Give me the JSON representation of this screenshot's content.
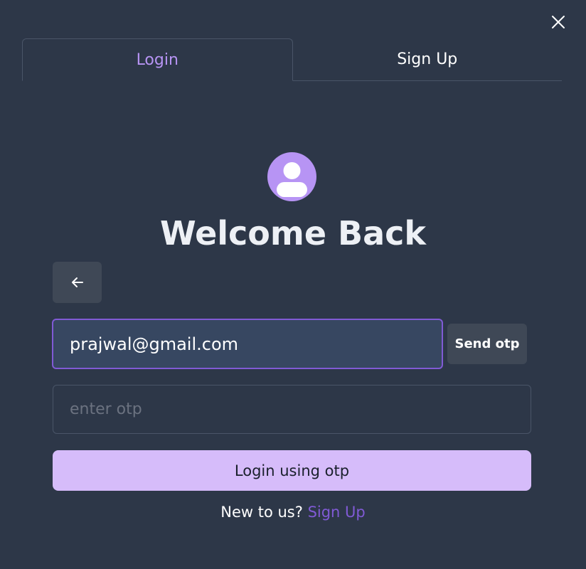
{
  "modal": {
    "close_icon": "close-icon",
    "tabs": [
      {
        "label": "Login",
        "active": true
      },
      {
        "label": "Sign Up",
        "active": false
      }
    ],
    "avatar_icon": "user-avatar-icon",
    "title": "Welcome Back",
    "back_icon": "arrow-left-icon",
    "email": {
      "value": "prajwal@gmail.com"
    },
    "send_otp_label": "Send otp",
    "otp": {
      "value": "",
      "placeholder": "enter otp"
    },
    "login_label": "Login using otp",
    "footer": {
      "prompt": "New to us?",
      "link": "Sign Up"
    }
  },
  "colors": {
    "background": "#2d3748",
    "accent": "#b794f4",
    "accent_dark": "#805ad5",
    "primary_button": "#d6bcfa"
  }
}
